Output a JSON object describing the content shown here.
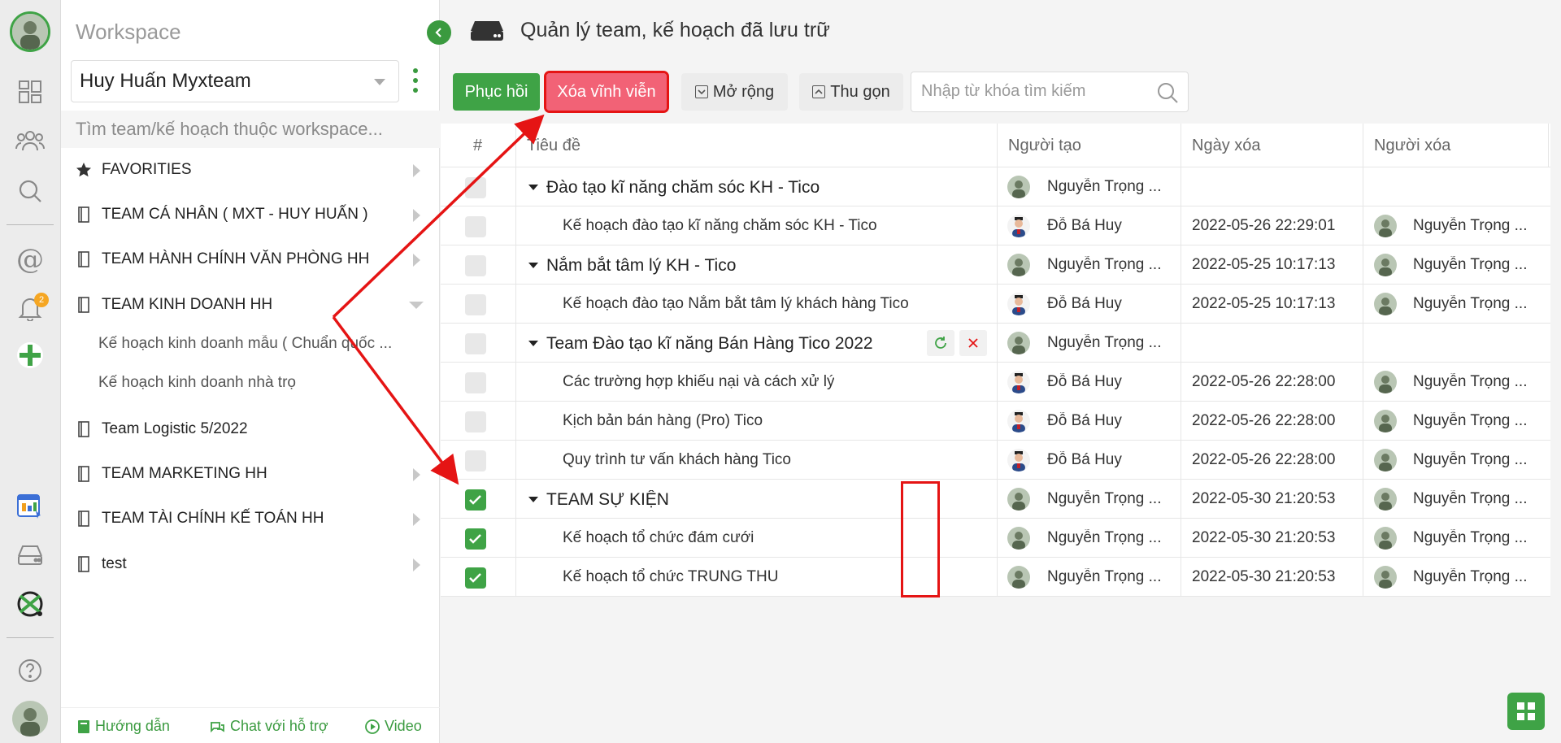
{
  "colors": {
    "accent": "#3fa346",
    "danger": "#f26276",
    "annotation": "#e51414"
  },
  "rail": {
    "notifications_badge": "2",
    "icons": [
      "user-avatar-icon",
      "dashboard-icon",
      "team-icon",
      "search-icon",
      "mention-icon",
      "bell-icon",
      "add-icon",
      "report-icon",
      "archive-icon",
      "myxteam-logo-icon",
      "help-icon",
      "profile-avatar-icon"
    ]
  },
  "sidebar": {
    "title": "Workspace",
    "workspace_name": "Huy Huấn Myxteam",
    "search_placeholder": "Tìm team/kế hoạch thuộc workspace...",
    "favorites": "FAVORITIES",
    "teams": [
      {
        "label": "TEAM CÁ NHÂN ( MXT - HUY HUẤN )"
      },
      {
        "label": "TEAM HÀNH CHÍNH VĂN PHÒNG HH"
      },
      {
        "label": "TEAM KINH DOANH HH"
      },
      {
        "label": "Team Logistic 5/2022"
      },
      {
        "label": "TEAM MARKETING HH"
      },
      {
        "label": "TEAM TÀI CHÍNH KẾ TOÁN HH"
      },
      {
        "label": "test"
      }
    ],
    "sub_items": [
      "Kế hoạch kinh doanh mẫu ( Chuẩn quốc ...",
      "Kế hoạch kinh doanh nhà trọ"
    ],
    "footer": {
      "guide": "Hướng dẫn",
      "chat": "Chat với hỗ trợ",
      "video": "Video"
    }
  },
  "main": {
    "title": "Quản lý team, kế hoạch đã lưu trữ",
    "buttons": {
      "restore": "Phục hồi",
      "delete": "Xóa vĩnh viễn",
      "expand": "Mở rộng",
      "collapse": "Thu gọn"
    },
    "search_placeholder": "Nhập từ khóa tìm kiếm",
    "columns": {
      "index": "#",
      "title": "Tiêu đề",
      "creator": "Người tạo",
      "deleted_at": "Ngày xóa",
      "deleted_by": "Người xóa"
    },
    "rows": [
      {
        "title": "Đào tạo kĩ năng chăm sóc KH - Tico",
        "group": true,
        "checked": false,
        "creator": "Nguyễn Trọng ...",
        "deleted_at": "",
        "deleted_by": ""
      },
      {
        "title": "Kế hoạch đào tạo kĩ năng chăm sóc KH - Tico",
        "group": false,
        "checked": false,
        "creator": "Đỗ Bá Huy",
        "deleted_at": "2022-05-26 22:29:01",
        "deleted_by": "Nguyễn Trọng ..."
      },
      {
        "title": "Nắm bắt tâm lý KH - Tico",
        "group": true,
        "checked": false,
        "creator": "Nguyễn Trọng ...",
        "deleted_at": "2022-05-25 10:17:13",
        "deleted_by": "Nguyễn Trọng ..."
      },
      {
        "title": "Kế hoạch đào tạo Nắm bắt tâm lý khách hàng Tico",
        "group": false,
        "checked": false,
        "creator": "Đỗ Bá Huy",
        "deleted_at": "2022-05-25 10:17:13",
        "deleted_by": "Nguyễn Trọng ..."
      },
      {
        "title": "Team Đào tạo kĩ năng Bán Hàng Tico 2022",
        "group": true,
        "checked": false,
        "creator": "Nguyễn Trọng ...",
        "deleted_at": "",
        "deleted_by": ""
      },
      {
        "title": "Các trường hợp khiếu nại và cách xử lý",
        "group": false,
        "checked": false,
        "creator": "Đỗ Bá Huy",
        "deleted_at": "2022-05-26 22:28:00",
        "deleted_by": "Nguyễn Trọng ..."
      },
      {
        "title": "Kịch bản bán hàng (Pro) Tico",
        "group": false,
        "checked": false,
        "creator": "Đỗ Bá Huy",
        "deleted_at": "2022-05-26 22:28:00",
        "deleted_by": "Nguyễn Trọng ..."
      },
      {
        "title": "Quy trình tư vấn khách hàng Tico",
        "group": false,
        "checked": false,
        "creator": "Đỗ Bá Huy",
        "deleted_at": "2022-05-26 22:28:00",
        "deleted_by": "Nguyễn Trọng ..."
      },
      {
        "title": "TEAM SỰ KIỆN",
        "group": true,
        "checked": true,
        "creator": "Nguyễn Trọng ...",
        "deleted_at": "2022-05-30 21:20:53",
        "deleted_by": "Nguyễn Trọng ..."
      },
      {
        "title": "Kế hoạch tổ chức đám cưới",
        "group": false,
        "checked": true,
        "creator": "Nguyễn Trọng ...",
        "deleted_at": "2022-05-30 21:20:53",
        "deleted_by": "Nguyễn Trọng ..."
      },
      {
        "title": "Kế hoạch tổ chức TRUNG THU",
        "group": false,
        "checked": true,
        "creator": "Nguyễn Trọng ...",
        "deleted_at": "2022-05-30 21:20:53",
        "deleted_by": "Nguyễn Trọng ..."
      }
    ]
  }
}
